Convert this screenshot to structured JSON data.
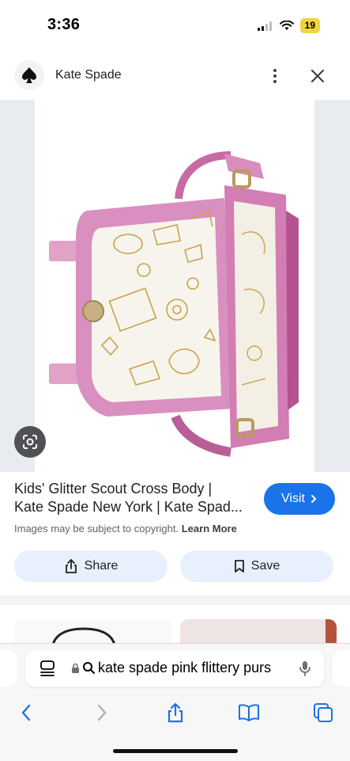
{
  "status_bar": {
    "time": "3:36",
    "battery": "19"
  },
  "site": {
    "name": "Kate Spade"
  },
  "result": {
    "title_line1": "Kids' Glitter Scout Cross Body |",
    "title_line2": "Kate Spade New York | Kate Spad...",
    "visit_label": "Visit",
    "copyright_text": "Images may be subject to copyright.",
    "learn_more": "Learn More"
  },
  "actions": {
    "share_label": "Share",
    "save_label": "Save"
  },
  "browser": {
    "url_text": "kate spade pink flittery purs"
  },
  "colors": {
    "accent": "#1a73e8",
    "pill_bg": "#e8f0fe",
    "purse_pink": "#d57fb2"
  },
  "icons": [
    "signal-icon",
    "wifi-icon",
    "spade-logo-icon",
    "more-vert-icon",
    "close-icon",
    "lens-icon",
    "chevron-right-icon",
    "share-icon",
    "bookmark-icon",
    "tabs-icon",
    "lock-icon",
    "search-icon",
    "mic-icon",
    "back-icon",
    "forward-icon",
    "bookmarks-icon"
  ]
}
